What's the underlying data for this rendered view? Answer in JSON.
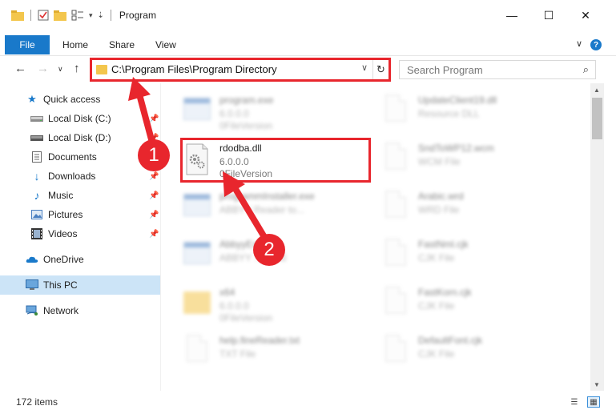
{
  "window": {
    "title": "Program",
    "minimize_glyph": "—",
    "maximize_glyph": "☐",
    "close_glyph": "✕"
  },
  "ribbon": {
    "tabs": [
      "File",
      "Home",
      "Share",
      "View"
    ],
    "help_glyph": "?",
    "collapse_glyph": "∨"
  },
  "address": {
    "path": "C:\\Program Files\\Program Directory",
    "search_placeholder": "Search Program"
  },
  "sidebar": {
    "items": [
      {
        "label": "Quick access",
        "icon": "star-icon",
        "pinned": false,
        "selected": false
      },
      {
        "label": "Local Disk (C:)",
        "icon": "drive-icon",
        "pinned": true,
        "selected": false
      },
      {
        "label": "Local Disk (D:)",
        "icon": "drive-icon",
        "pinned": true,
        "selected": false
      },
      {
        "label": "Documents",
        "icon": "documents-icon",
        "pinned": true,
        "selected": false
      },
      {
        "label": "Downloads",
        "icon": "download-icon",
        "pinned": true,
        "selected": false
      },
      {
        "label": "Music",
        "icon": "music-icon",
        "pinned": true,
        "selected": false
      },
      {
        "label": "Pictures",
        "icon": "pictures-icon",
        "pinned": true,
        "selected": false
      },
      {
        "label": "Videos",
        "icon": "videos-icon",
        "pinned": true,
        "selected": false
      },
      {
        "label": "OneDrive",
        "icon": "cloud-icon",
        "pinned": false,
        "selected": false
      },
      {
        "label": "This PC",
        "icon": "computer-icon",
        "pinned": false,
        "selected": true
      },
      {
        "label": "Network",
        "icon": "network-icon",
        "pinned": false,
        "selected": false
      }
    ]
  },
  "files": {
    "left": [
      {
        "name": "program.exe",
        "line1": "6.0.0.0",
        "line2": "0FileVersion",
        "kind": "exe",
        "highlighted": false
      },
      {
        "name": "rdodba.dll",
        "line1": "6.0.0.0",
        "line2": "0FileVersion",
        "kind": "dll",
        "highlighted": true
      },
      {
        "name": "programmInstaller.exe",
        "line1": "ABBYY Reader to...",
        "line2": "",
        "kind": "exe",
        "highlighted": false
      },
      {
        "name": "AbbyyExe.exe",
        "line1": "ABBYY ... hand",
        "line2": "",
        "kind": "exe",
        "highlighted": false
      },
      {
        "name": "x64",
        "line1": "6.0.0.0",
        "line2": "0FileVersion",
        "kind": "folder",
        "highlighted": false
      },
      {
        "name": "help.fineReader.txt",
        "line1": "TXT File",
        "line2": "",
        "kind": "doc",
        "highlighted": false
      }
    ],
    "right": [
      {
        "name": "UpdateClient19.dll",
        "line1": "Resource DLL",
        "line2": "",
        "kind": "doc"
      },
      {
        "name": "SndToWP12.wcm",
        "line1": "WCM File",
        "line2": "",
        "kind": "doc"
      },
      {
        "name": "Arabic.wrd",
        "line1": "WRD File",
        "line2": "",
        "kind": "doc"
      },
      {
        "name": "FastNml.cjk",
        "line1": "CJK File",
        "line2": "",
        "kind": "doc"
      },
      {
        "name": "FastKorn.cjk",
        "line1": "CJK File",
        "line2": "",
        "kind": "doc"
      },
      {
        "name": "DefaultFont.cjk",
        "line1": "CJK File",
        "line2": "",
        "kind": "doc"
      }
    ]
  },
  "status": {
    "items_count": "172 items"
  },
  "annotations": {
    "badge1": "1",
    "badge2": "2",
    "color": "#e8262d"
  },
  "colors": {
    "accent": "#1979ca",
    "selected_bg": "#cce4f7",
    "folder": "#f3c64d"
  }
}
